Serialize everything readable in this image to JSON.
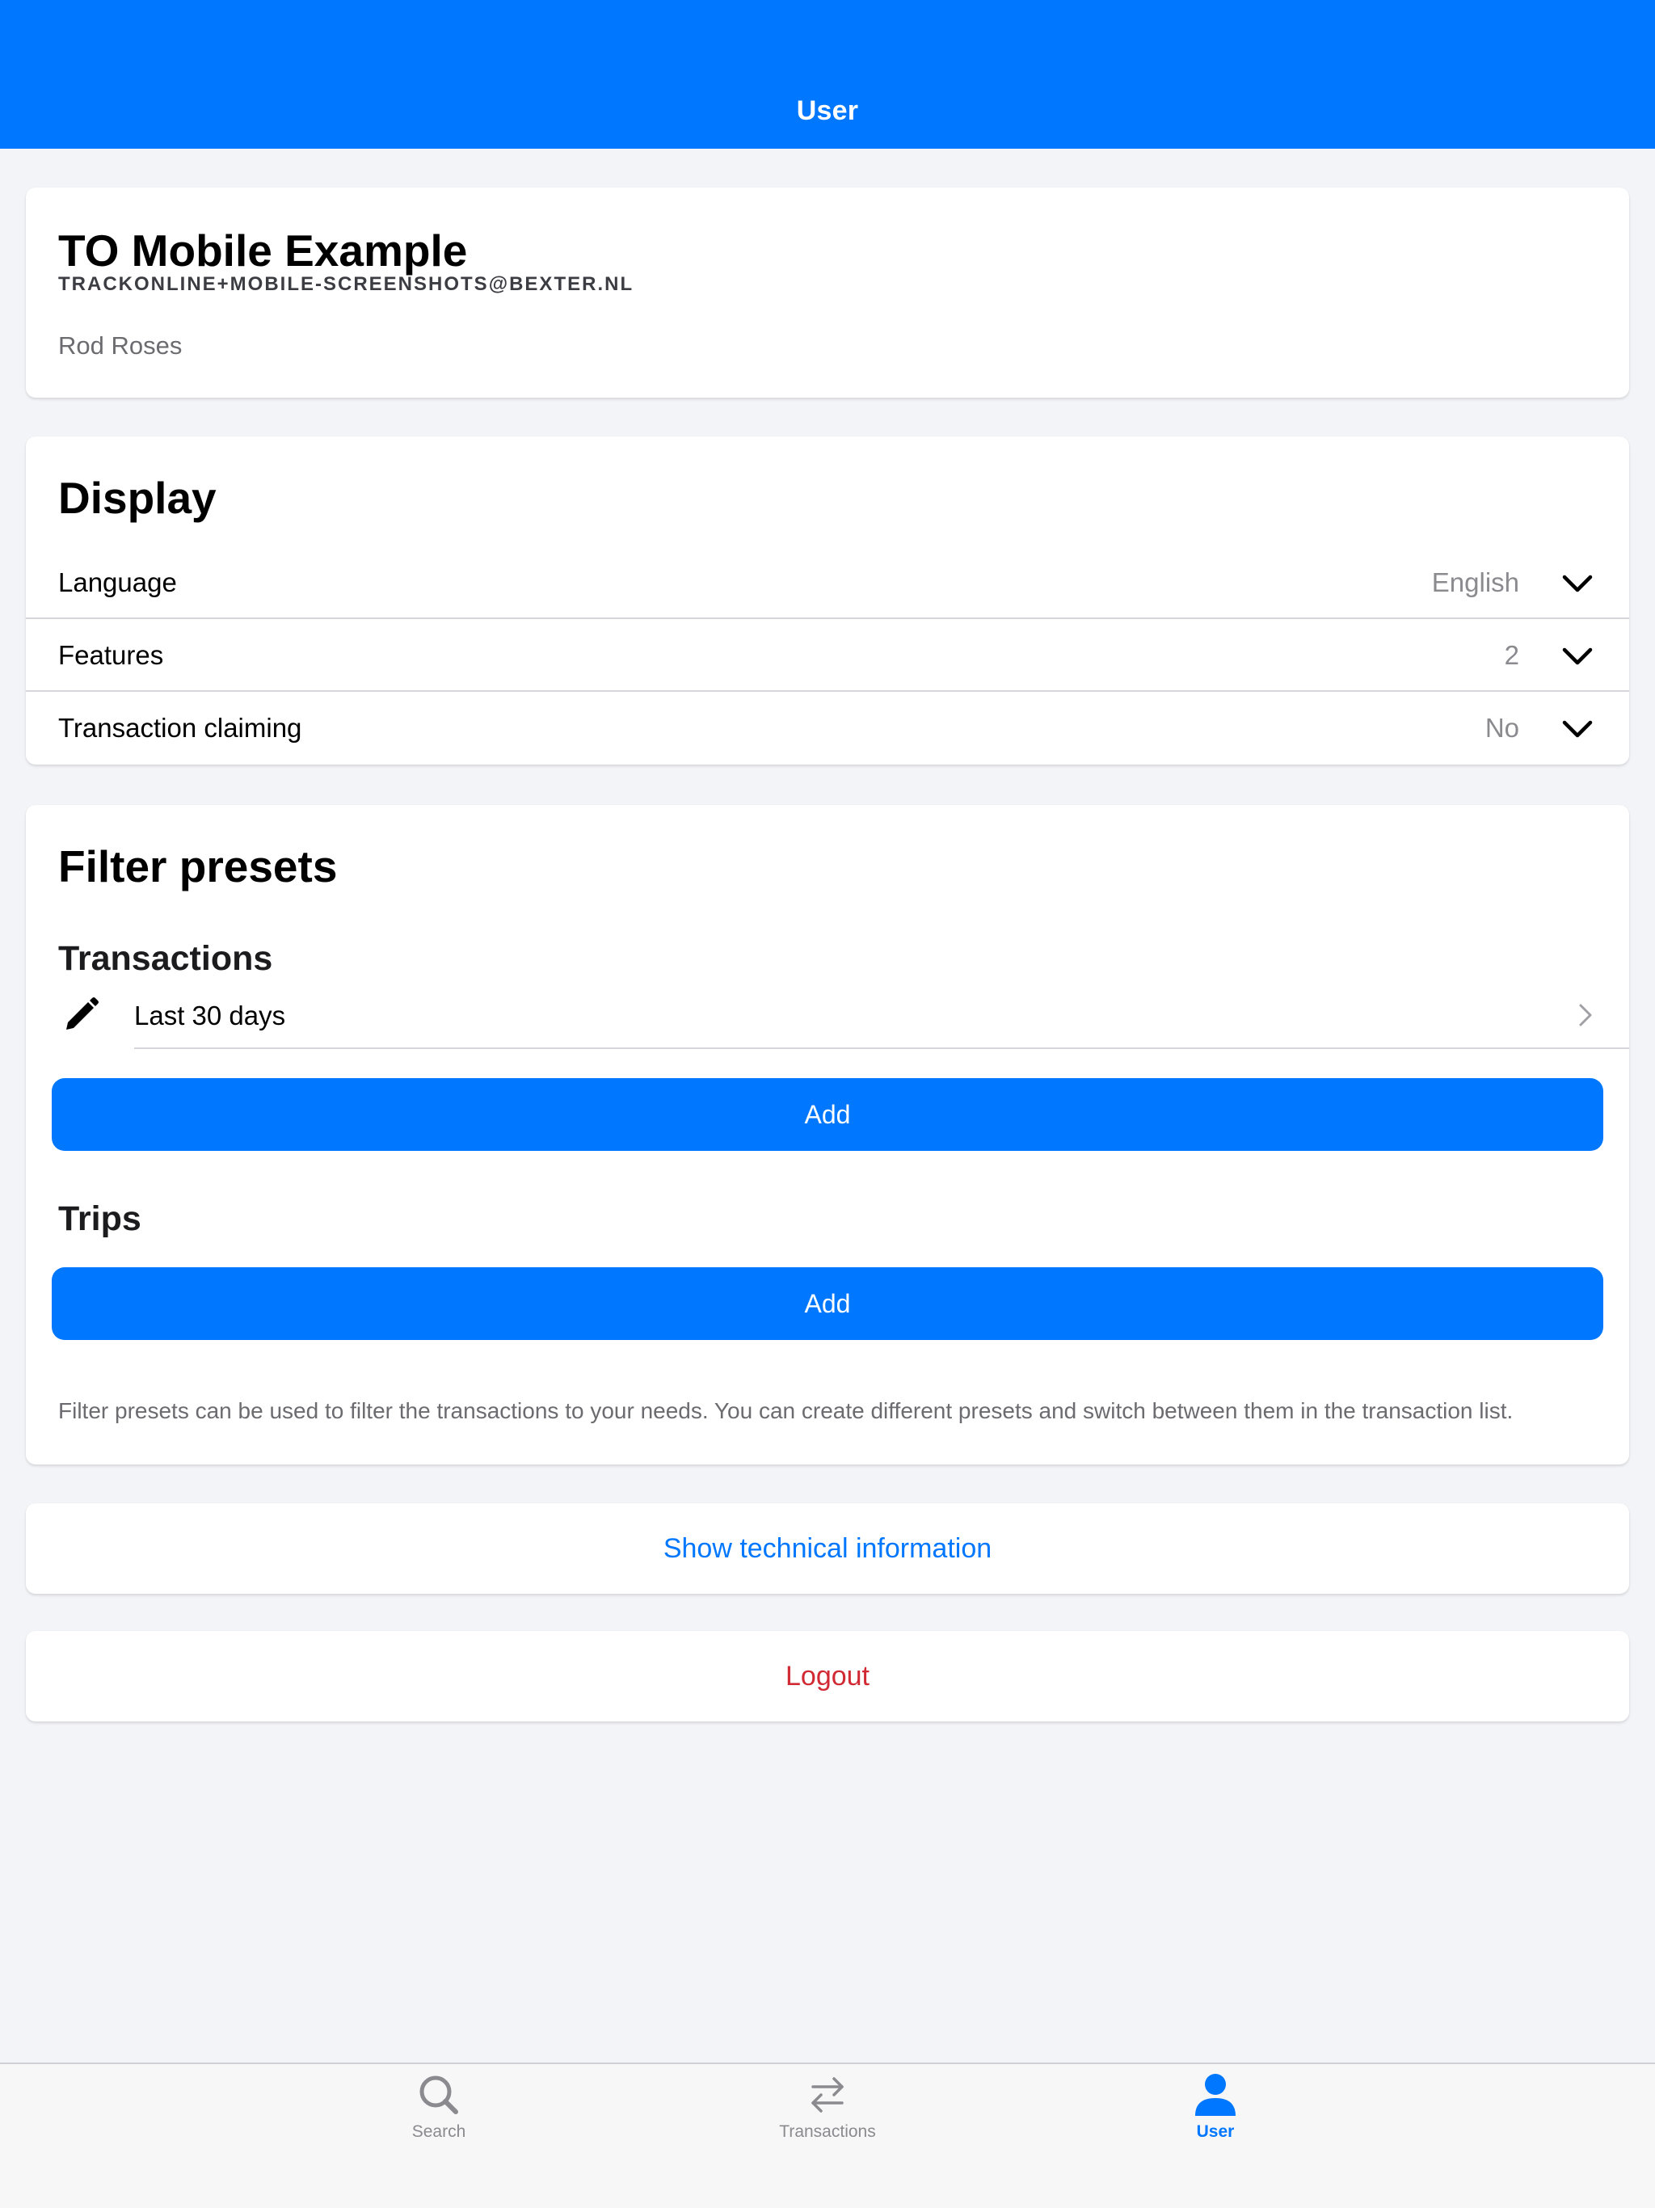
{
  "header": {
    "title": "User"
  },
  "profile": {
    "name": "TO Mobile Example",
    "email": "TRACKONLINE+MOBILE-SCREENSHOTS@BEXTER.NL",
    "organization": "Rod Roses"
  },
  "display": {
    "title": "Display",
    "rows": [
      {
        "label": "Language",
        "value": "English"
      },
      {
        "label": "Features",
        "value": "2"
      },
      {
        "label": "Transaction claiming",
        "value": "No"
      }
    ]
  },
  "filter_presets": {
    "title": "Filter presets",
    "transactions": {
      "heading": "Transactions",
      "presets": [
        {
          "label": "Last 30 days"
        }
      ],
      "add_label": "Add"
    },
    "trips": {
      "heading": "Trips",
      "add_label": "Add"
    },
    "help_text": "Filter presets can be used to filter the transactions to your needs. You can create different presets and switch between them in the transaction list."
  },
  "actions": {
    "technical_info_label": "Show technical information",
    "logout_label": "Logout"
  },
  "tabbar": {
    "tabs": [
      {
        "label": "Search",
        "icon": "search-icon",
        "active": false
      },
      {
        "label": "Transactions",
        "icon": "transfer-arrows-icon",
        "active": false
      },
      {
        "label": "User",
        "icon": "user-icon",
        "active": true
      }
    ]
  },
  "colors": {
    "accent": "#0077ff",
    "danger": "#d12a34",
    "inactive_tab": "#8a8a8f",
    "background": "#f3f4f8"
  }
}
